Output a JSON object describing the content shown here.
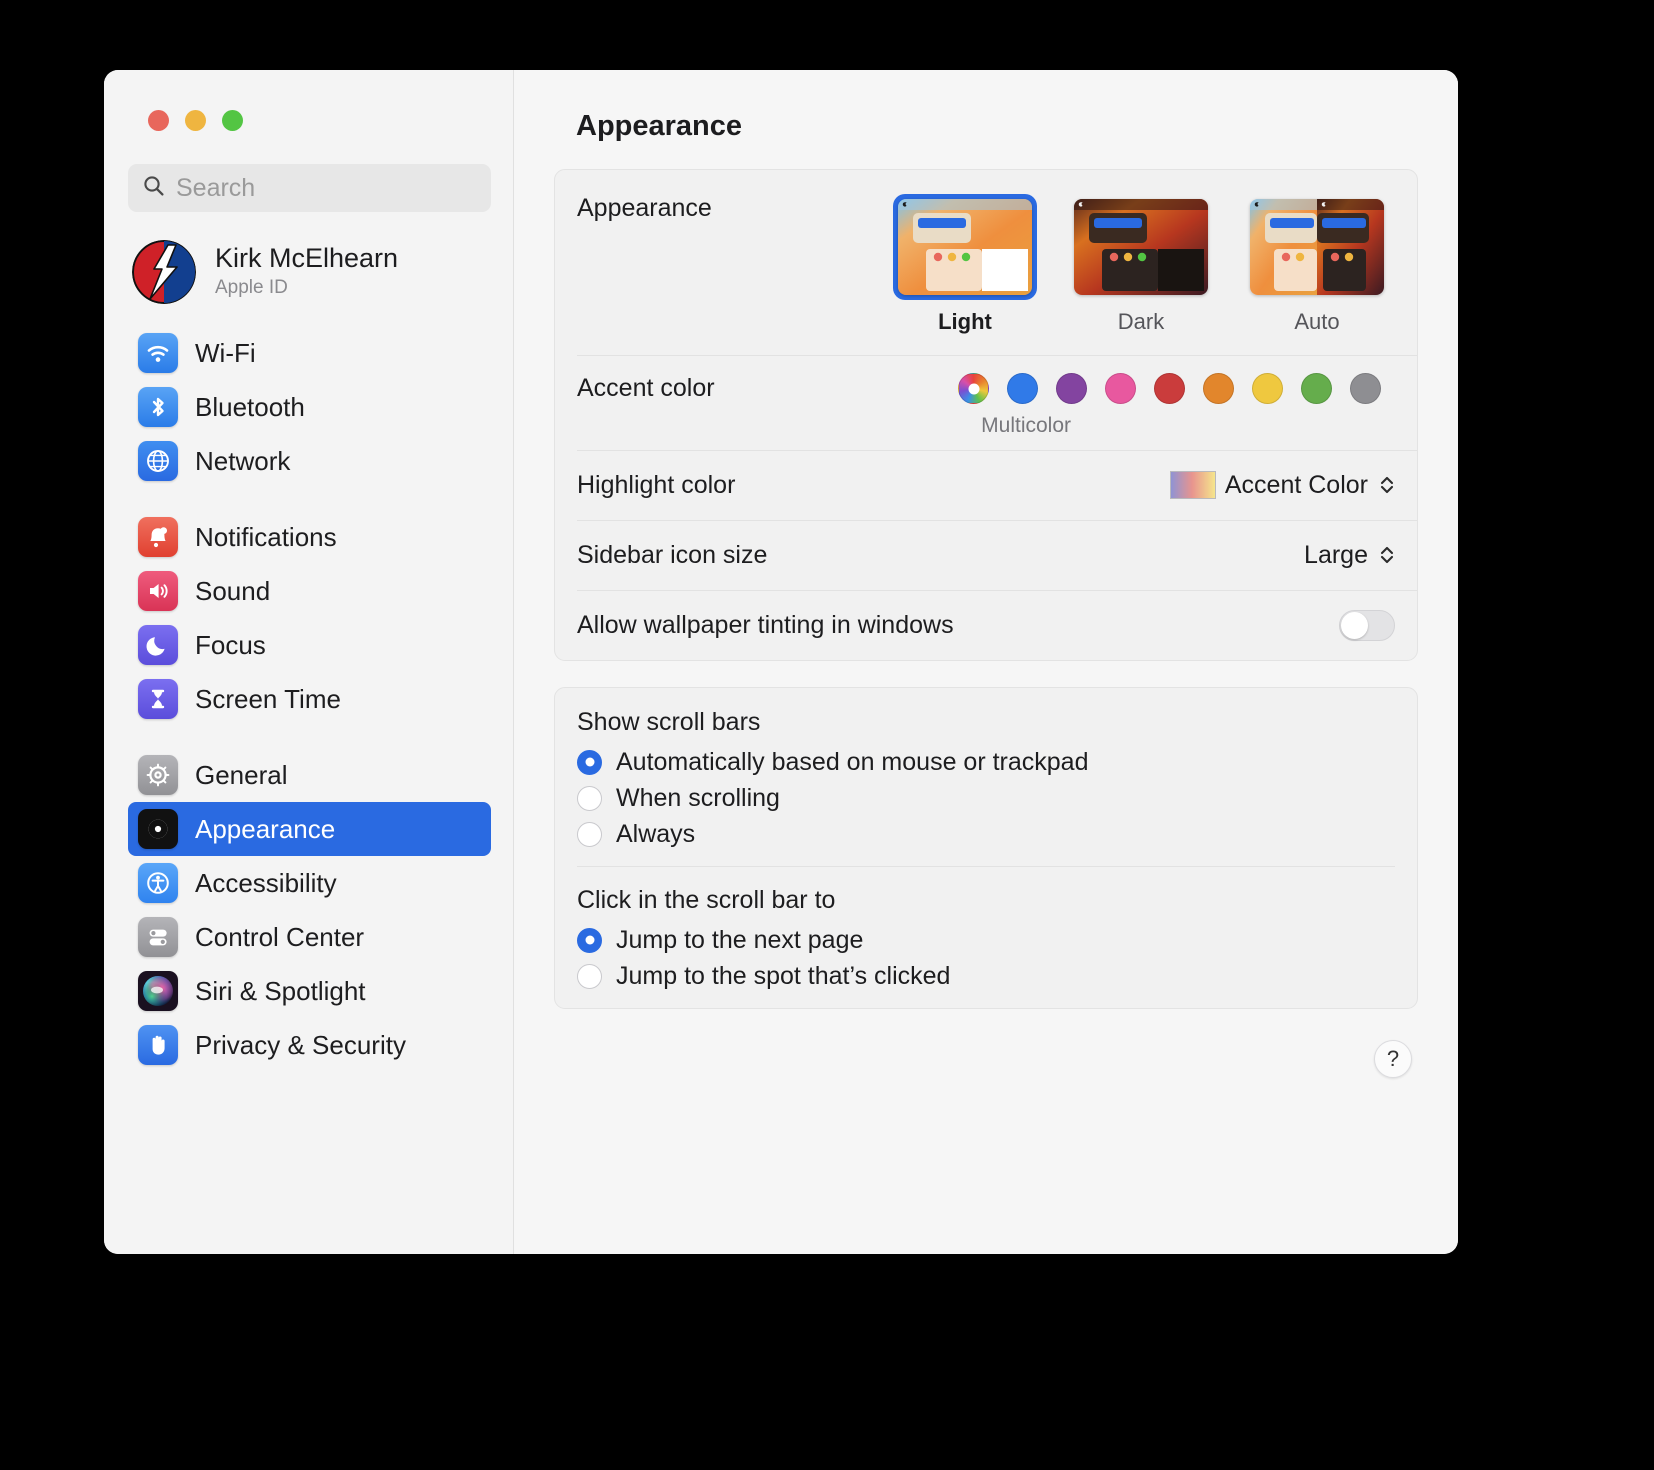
{
  "window": {
    "traffic_lights": [
      "close",
      "minimize",
      "zoom"
    ],
    "colors": {
      "accent": "#2a6ae1",
      "close": "#e8675c",
      "minimize": "#efb540",
      "zoom": "#53c543"
    }
  },
  "search": {
    "placeholder": "Search",
    "icon": "search-icon"
  },
  "account": {
    "name": "Kirk McElhearn",
    "subtitle": "Apple ID",
    "avatar": "steal-your-face-avatar"
  },
  "sidebar": {
    "groups": [
      {
        "items": [
          {
            "label": "Wi-Fi",
            "icon": "wifi-icon",
            "selected": false
          },
          {
            "label": "Bluetooth",
            "icon": "bluetooth-icon",
            "selected": false
          },
          {
            "label": "Network",
            "icon": "network-globe-icon",
            "selected": false
          }
        ]
      },
      {
        "items": [
          {
            "label": "Notifications",
            "icon": "notifications-bell-icon",
            "selected": false
          },
          {
            "label": "Sound",
            "icon": "sound-speaker-icon",
            "selected": false
          },
          {
            "label": "Focus",
            "icon": "focus-moon-icon",
            "selected": false
          },
          {
            "label": "Screen Time",
            "icon": "screen-time-hourglass-icon",
            "selected": false
          }
        ]
      },
      {
        "items": [
          {
            "label": "General",
            "icon": "general-gear-icon",
            "selected": false
          },
          {
            "label": "Appearance",
            "icon": "appearance-contrast-icon",
            "selected": true
          },
          {
            "label": "Accessibility",
            "icon": "accessibility-icon",
            "selected": false
          },
          {
            "label": "Control Center",
            "icon": "control-center-icon",
            "selected": false
          },
          {
            "label": "Siri & Spotlight",
            "icon": "siri-orb-icon",
            "selected": false
          },
          {
            "label": "Privacy & Security",
            "icon": "privacy-hand-icon",
            "selected": false
          }
        ]
      }
    ]
  },
  "detail": {
    "title": "Appearance",
    "appearance": {
      "label": "Appearance",
      "options": [
        {
          "name": "Light",
          "selected": true
        },
        {
          "name": "Dark",
          "selected": false
        },
        {
          "name": "Auto",
          "selected": false
        }
      ]
    },
    "accent": {
      "label": "Accent color",
      "selected_name": "Multicolor",
      "swatches": [
        {
          "name": "Multicolor",
          "color": "multicolor",
          "selected": true
        },
        {
          "name": "Blue",
          "color": "#307ae8"
        },
        {
          "name": "Purple",
          "color": "#8344a0"
        },
        {
          "name": "Pink",
          "color": "#e8589f"
        },
        {
          "name": "Red",
          "color": "#ca3c3c"
        },
        {
          "name": "Orange",
          "color": "#e2862c"
        },
        {
          "name": "Yellow",
          "color": "#efc83f"
        },
        {
          "name": "Green",
          "color": "#65ad4c"
        },
        {
          "name": "Graphite",
          "color": "#8e8e92"
        }
      ]
    },
    "highlight": {
      "label": "Highlight color",
      "value": "Accent Color"
    },
    "sidebar_icon_size": {
      "label": "Sidebar icon size",
      "value": "Large"
    },
    "wallpaper_tinting": {
      "label": "Allow wallpaper tinting in windows",
      "enabled": false
    },
    "scroll_bars": {
      "title": "Show scroll bars",
      "options": [
        {
          "label": "Automatically based on mouse or trackpad",
          "selected": true
        },
        {
          "label": "When scrolling",
          "selected": false
        },
        {
          "label": "Always",
          "selected": false
        }
      ]
    },
    "click_scroll_bar": {
      "title": "Click in the scroll bar to",
      "options": [
        {
          "label": "Jump to the next page",
          "selected": true
        },
        {
          "label": "Jump to the spot that’s clicked",
          "selected": false
        }
      ]
    },
    "help": {
      "label": "?"
    }
  }
}
